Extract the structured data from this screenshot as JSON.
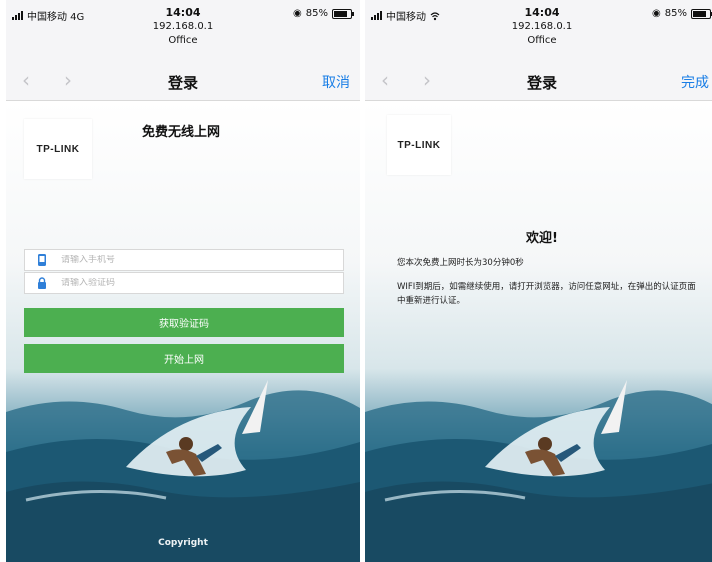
{
  "status": {
    "left_carrier": "中国移动 4G",
    "right_carrier": "中国移动",
    "time": "14:04",
    "ip": "192.168.0.1",
    "network_name": "Office",
    "battery": "85%",
    "battery_level": 0.85
  },
  "nav": {
    "title": "登录",
    "back_icon": "chevron-left-icon",
    "forward_icon": "chevron-right-icon",
    "left_action": "取消",
    "right_action": "完成",
    "action_color": "#1a7ee6"
  },
  "login": {
    "logo_text": "TP-LINK",
    "heading": "免费无线上网",
    "phone_placeholder": "请输入手机号",
    "code_placeholder": "请输入验证码",
    "get_code_button": "获取验证码",
    "start_button": "开始上网",
    "copyright": "Copyright",
    "button_color": "#4caf50"
  },
  "welcome": {
    "logo_text": "TP-LINK",
    "title": "欢迎!",
    "duration_text": "您本次免费上网时长为30分钟0秒",
    "expire_text": "WIFI到期后，如需继续使用，请打开浏览器，访问任意网址，在弹出的认证页面中重新进行认证。"
  }
}
